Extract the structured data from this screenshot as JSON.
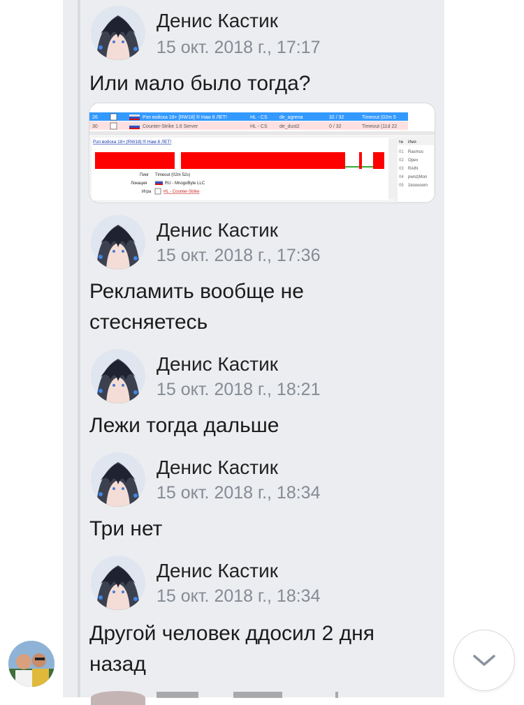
{
  "messages": [
    {
      "author": "Денис Кастик",
      "date": "15 окт. 2018 г., 17:17",
      "text": "Или мало было тогда?"
    },
    {
      "author": "Денис Кастик",
      "date": "15 окт. 2018 г., 17:36",
      "text_line1": "Рекламить вообще не",
      "text_line2": "стесняетесь"
    },
    {
      "author": "Денис Кастик",
      "date": "15 окт. 2018 г., 18:21",
      "text": "Лежи тогда дальше"
    },
    {
      "author": "Денис Кастик",
      "date": "15 окт. 2018 г., 18:34",
      "text": "Три нет"
    },
    {
      "author": "Денис Кастик",
      "date": "15 окт. 2018 г., 18:34",
      "text_line1": "Другой человек ддосил 2 дня",
      "text_line2": "назад"
    }
  ],
  "attachment": {
    "row1": {
      "num": "26",
      "name": "Рэп войска 18+ [RW18] ® Нам 8 ЛЕТ!",
      "game": "HL - CS",
      "map": "de_agrena",
      "players": "32 / 32",
      "status": "Timeout (02m 5"
    },
    "row2": {
      "num": "30",
      "name": "Counter-Strike 1.6 Server",
      "game": "HL - CS",
      "map": "de_dust2",
      "players": "0 / 32",
      "status": "Timeout (11d 22"
    },
    "server_link": "Рэп войска 18+ [RW18] ® Нам 8 ЛЕТ!",
    "ping_label": "Пинг",
    "ping_value": "Timeout (02m 52s)",
    "location_label": "Локация",
    "location_value": "RU - MnogoByte LLC",
    "game_label": "Игра",
    "game_value": "HL - Counter-Strike",
    "players_header_num": "№",
    "players_header_name": "Имя",
    "players": [
      {
        "num": "01",
        "name": "Rasmus"
      },
      {
        "num": "02",
        "name": "Opex"
      },
      {
        "num": "03",
        "name": "RAIN"
      },
      {
        "num": "04",
        "name": "pwnz|Mon"
      },
      {
        "num": "05",
        "name": "1kooooom"
      }
    ]
  },
  "colors": {
    "panel": "#ebedf0",
    "red": "#ff0000",
    "date": "#858b94"
  }
}
